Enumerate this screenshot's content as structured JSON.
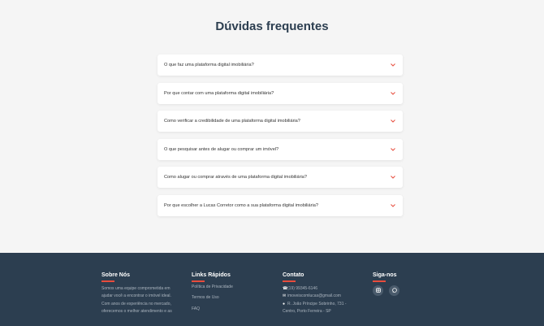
{
  "faq": {
    "title": "Dúvidas frequentes",
    "items": [
      {
        "question": "O que faz uma plataforma digital imobiliária?"
      },
      {
        "question": "Por que contar com uma plataforma digital imobiliária?"
      },
      {
        "question": "Como verificar a credibilidade de uma plataforma digital imobiliária?"
      },
      {
        "question": "O que pesquisar antes de alugar ou comprar um imóvel?"
      },
      {
        "question": "Como alugar ou comprar através de uma plataforma digital imobiliária?"
      },
      {
        "question": "Por que escolher a Lucas Corretor como a sua plataforma digital imobiliária?"
      }
    ]
  },
  "footer": {
    "about": {
      "heading": "Sobre Nós",
      "lines": [
        "Somos uma equipe comprometida em",
        "ajudar você a encontrar o imóvel ideal.",
        "Com anos de experiência no mercado,",
        "oferecemos o melhor atendimento e as"
      ]
    },
    "links": {
      "heading": "Links Rápidos",
      "items": [
        "Política de Privacidade",
        "Termos de Uso",
        "FAQ"
      ]
    },
    "contact": {
      "heading": "Contato",
      "phone": "(19) 99345-6146",
      "email": "imoveiscomlucas@gmail.com",
      "address_line1": "R. João Príncipe Sobrinho, 731 -",
      "address_line2": "Centro, Porto Ferreira - SP"
    },
    "social": {
      "heading": "Siga-nos",
      "icons": [
        "instagram-icon",
        "whatsapp-icon"
      ]
    }
  },
  "colors": {
    "accent": "#e74c3c",
    "footer_bg": "#2c3e50",
    "page_bg": "#f5f5f5"
  }
}
